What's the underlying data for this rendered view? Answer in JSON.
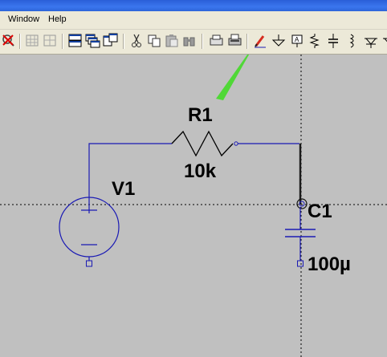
{
  "menubar": {
    "window_label": "Window",
    "help_label": "Help"
  },
  "toolbar": {
    "icons": [
      "zoom-cancel-icon",
      "autorange-icon",
      "grid-icon",
      "tile-horizontal-icon",
      "cascade-icon",
      "tile-vertical-icon",
      "cut-icon",
      "copy-icon",
      "paste-icon",
      "find-icon",
      "print-setup-icon",
      "print-icon",
      "draw-wire-icon",
      "ground-icon",
      "label-net-icon",
      "resistor-icon",
      "capacitor-icon",
      "inductor-icon",
      "diode-icon"
    ]
  },
  "schematic": {
    "resistor": {
      "name": "R1",
      "value": "10k"
    },
    "voltage_source": {
      "name": "V1"
    },
    "capacitor": {
      "name": "C1",
      "value": "100µ"
    }
  },
  "colors": {
    "canvas": "#c0c0c0",
    "wire": "#1a1ab4",
    "pointer_arrow": "#3cdc1e",
    "titlebar": "#2a5fd8",
    "menubar": "#ece9d8"
  }
}
